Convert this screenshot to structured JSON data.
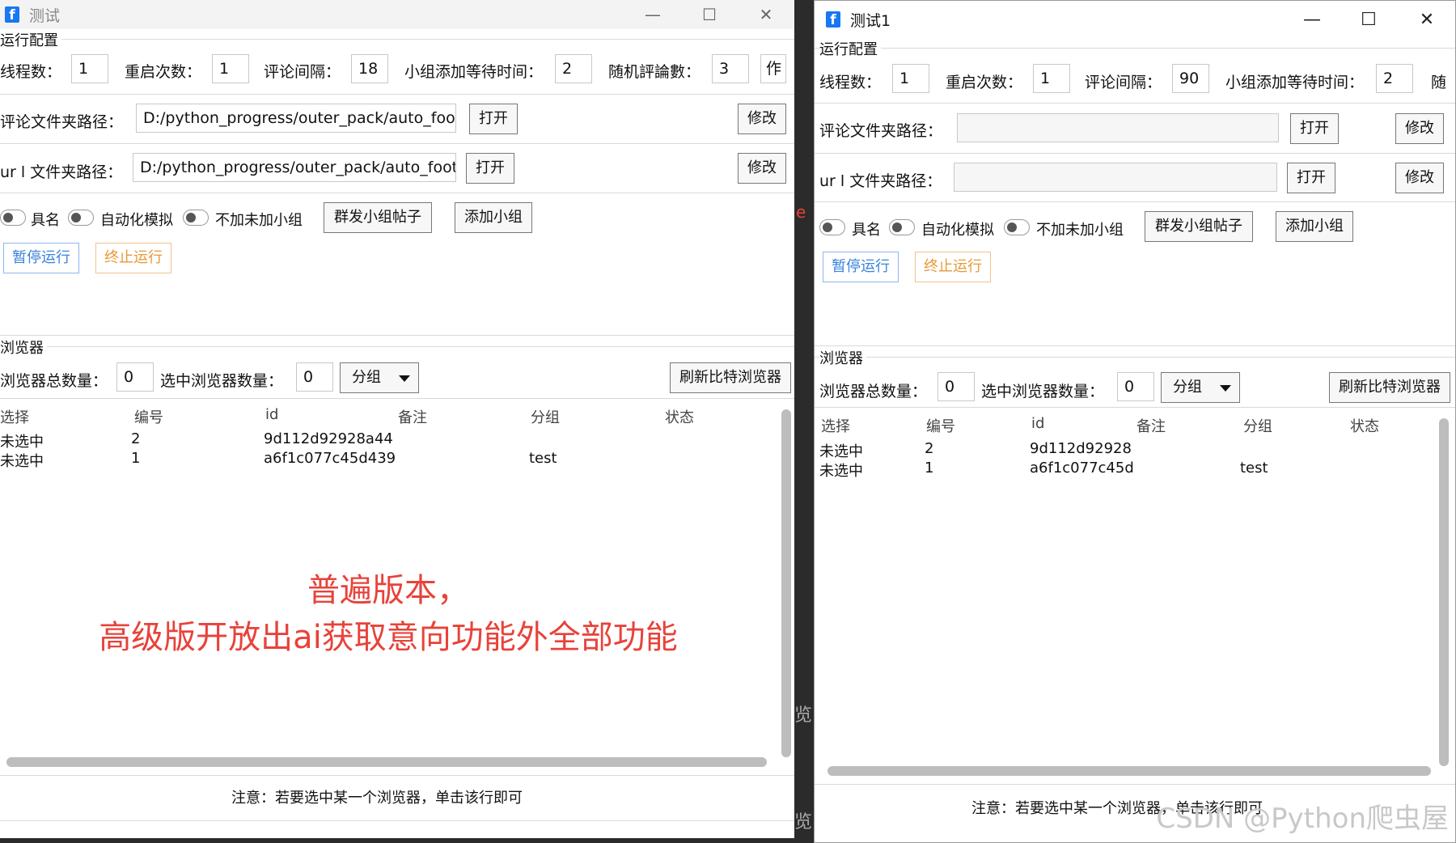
{
  "window1": {
    "title": "测试",
    "controls": {
      "minimize": "—",
      "maximize": "☐",
      "close": "✕"
    },
    "run_config": {
      "group_label": "运行配置",
      "threads_label": "线程数：",
      "threads_value": "1",
      "restart_label": "重启次数：",
      "restart_value": "1",
      "interval_label": "评论间隔：",
      "interval_value": "18",
      "group_wait_label": "小组添加等待时间：",
      "group_wait_value": "2",
      "random_comments_label": "随机評論數：",
      "random_comments_value": "3",
      "extra_value": "作",
      "comment_path_label": "评论文件夹路径：",
      "comment_path_value": "D:/python_progress/outer_pack/auto_foot/B",
      "url_path_label": "ur l 文件夹路径：",
      "url_path_value": "D:/python_progress/outer_pack/auto_foot/B",
      "open_label": "打开",
      "modify_label": "修改",
      "toggle_anonymous": "具名",
      "toggle_automation": "自动化模拟",
      "toggle_no_join": "不加未加小组",
      "mass_post_label": "群发小组帖子",
      "add_group_label": "添加小组",
      "pause_label": "暂停运行",
      "stop_label": "终止运行"
    },
    "browser": {
      "group_label": "浏览器",
      "total_label": "浏览器总数量：",
      "total_value": "0",
      "selected_label": "选中浏览器数量：",
      "selected_value": "0",
      "group_select": "分组",
      "refresh_label": "刷新比特浏览器",
      "columns": [
        "选择",
        "编号",
        "id",
        "备注",
        "分组",
        "状态"
      ],
      "rows": [
        {
          "select": "未选中",
          "number": "2",
          "id": "9d112d92928a44",
          "remark": "",
          "group": "",
          "status": ""
        },
        {
          "select": "未选中",
          "number": "1",
          "id": "a6f1c077c45d439",
          "remark": "test",
          "group": "",
          "status": ""
        }
      ]
    },
    "promo_line1": "普遍版本，",
    "promo_line2": "高级版开放出ai获取意向功能外全部功能",
    "note": "注意：若要选中某一个浏览器，单击该行即可"
  },
  "window2": {
    "title": "测试1",
    "controls": {
      "minimize": "—",
      "maximize": "☐",
      "close": "✕"
    },
    "run_config": {
      "group_label": "运行配置",
      "threads_label": "线程数：",
      "threads_value": "1",
      "restart_label": "重启次数：",
      "restart_value": "1",
      "interval_label": "评论间隔：",
      "interval_value": "90",
      "group_wait_label": "小组添加等待时间：",
      "group_wait_value": "2",
      "random_comments_label": "随",
      "comment_path_label": "评论文件夹路径：",
      "url_path_label": "ur l 文件夹路径：",
      "open_label": "打开",
      "modify_label": "修改",
      "toggle_anonymous": "具名",
      "toggle_automation": "自动化模拟",
      "toggle_no_join": "不加未加小组",
      "mass_post_label": "群发小组帖子",
      "add_group_label": "添加小组",
      "pause_label": "暂停运行",
      "stop_label": "终止运行"
    },
    "browser": {
      "group_label": "浏览器",
      "total_label": "浏览器总数量：",
      "total_value": "0",
      "selected_label": "选中浏览器数量：",
      "selected_value": "0",
      "group_select": "分组",
      "refresh_label": "刷新比特浏览器",
      "columns": [
        "选择",
        "编号",
        "id",
        "备注",
        "分组",
        "状态"
      ],
      "rows": [
        {
          "select": "未选中",
          "number": "2",
          "id": "9d112d92928",
          "remark": "",
          "group": "",
          "status": ""
        },
        {
          "select": "未选中",
          "number": "1",
          "id": "a6f1c077c45d",
          "remark": "",
          "group": "test",
          "status": ""
        }
      ]
    },
    "note": "注意：若要选中某一个浏览器，单击该行即可"
  },
  "background_fragments": {
    "a": "e",
    "b": "览",
    "c": "览"
  },
  "watermark": "CSDN @Python爬虫屋"
}
